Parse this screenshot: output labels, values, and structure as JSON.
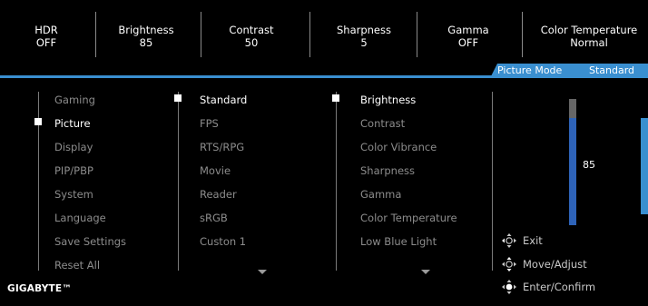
{
  "status_bar": [
    {
      "name": "HDR",
      "value": "OFF"
    },
    {
      "name": "Brightness",
      "value": "85"
    },
    {
      "name": "Contrast",
      "value": "50"
    },
    {
      "name": "Sharpness",
      "value": "5"
    },
    {
      "name": "Gamma",
      "value": "OFF"
    },
    {
      "name": "Color Temperature",
      "value": "Normal"
    }
  ],
  "mode": {
    "label": "Picture Mode",
    "value": "Standard"
  },
  "main_menu": {
    "items": [
      "Gaming",
      "Picture",
      "Display",
      "PIP/PBP",
      "System",
      "Language",
      "Save Settings",
      "Reset All"
    ],
    "selected": "Picture"
  },
  "picture_modes": {
    "items": [
      "Standard",
      "FPS",
      "RTS/RPG",
      "Movie",
      "Reader",
      "sRGB",
      "Custon 1"
    ],
    "selected": "Standard"
  },
  "settings": {
    "items": [
      "Brightness",
      "Contrast",
      "Color Vibrance",
      "Sharpness",
      "Gamma",
      "Color Temperature",
      "Low Blue Light"
    ],
    "selected": "Brightness"
  },
  "slider": {
    "value": "85",
    "level": 0.85
  },
  "help": [
    {
      "icon": "joystick-left-icon",
      "label": "Exit"
    },
    {
      "icon": "joystick-move-icon",
      "label": "Move/Adjust"
    },
    {
      "icon": "joystick-press-icon",
      "label": "Enter/Confirm"
    }
  ],
  "logo": "GIGABYTE™",
  "colors": {
    "accent": "#3a8fd0",
    "slider_fill": "#2e63b8",
    "background": "#000000"
  }
}
